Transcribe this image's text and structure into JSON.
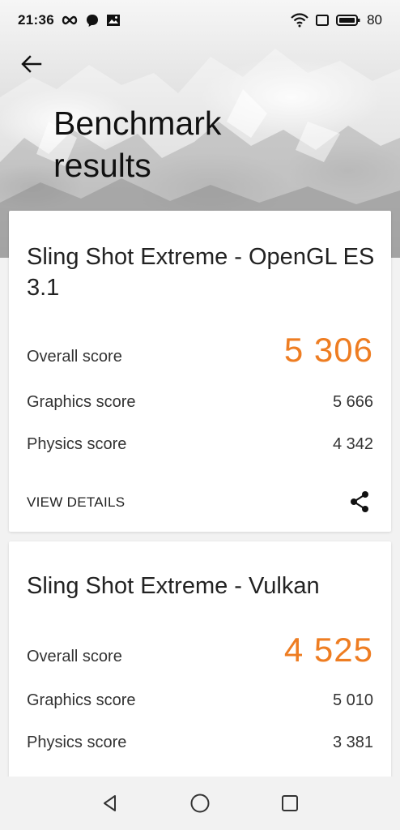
{
  "status_bar": {
    "time": "21:36",
    "battery": "80",
    "icons": [
      "infinity-icon",
      "chat-icon",
      "image-icon",
      "wifi-icon",
      "screen-icon",
      "battery-icon"
    ]
  },
  "header": {
    "title": "Benchmark results",
    "back_icon": "back-arrow-icon"
  },
  "results": [
    {
      "title": "Sling Shot Extreme - OpenGL ES 3.1",
      "overall_label": "Overall score",
      "overall_value": "5 306",
      "graphics_label": "Graphics score",
      "graphics_value": "5 666",
      "physics_label": "Physics score",
      "physics_value": "4 342",
      "details_label": "VIEW DETAILS",
      "share_icon": "share-icon"
    },
    {
      "title": "Sling Shot Extreme - Vulkan",
      "overall_label": "Overall score",
      "overall_value": "4 525",
      "graphics_label": "Graphics score",
      "graphics_value": "5 010",
      "physics_label": "Physics score",
      "physics_value": "3 381"
    }
  ],
  "nav_bar": {
    "icons": [
      "back-triangle-icon",
      "home-circle-icon",
      "recents-square-icon"
    ]
  },
  "colors": {
    "accent": "#ee7d22",
    "card": "#ffffff",
    "background": "#f2f2f2"
  }
}
